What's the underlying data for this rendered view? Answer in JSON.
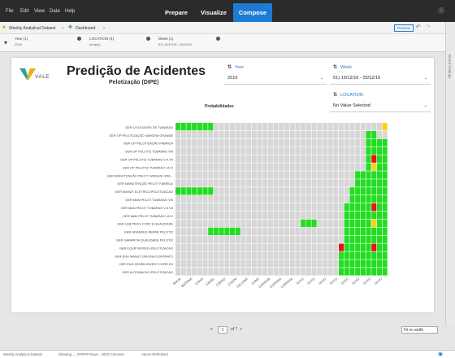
{
  "menubar": {
    "menus": [
      "File",
      "Edit",
      "View",
      "Data",
      "Help"
    ],
    "tabs": [
      "Prepare",
      "Visualize",
      "Compose"
    ],
    "active_tab": "Compose"
  },
  "toolbar": {
    "dataset": "Weekly Analytical Dataset",
    "canvas": "Dashboard",
    "preview": "Preview"
  },
  "filter_bar": [
    {
      "label": "Year (1)",
      "value": "2016"
    },
    {
      "label": "LOCATION (4)",
      "value": "(empty)"
    },
    {
      "label": "Week (1)",
      "value": "51) 19/12/16 - 25/12/16"
    }
  ],
  "right_rail_label": "Board Settings",
  "header": {
    "logo_text": "VALE",
    "title": "Predição de Acidentes",
    "subtitle": "Pelotização (DIPE)"
  },
  "filters": {
    "year": {
      "label": "Year",
      "value": "2016"
    },
    "week": {
      "label": "Week",
      "value": "51) 19/12/16 - 25/12/16"
    },
    "location": {
      "label": "LOCATION",
      "value": "No Value Selected"
    }
  },
  "chart_data": {
    "type": "heatmap",
    "title": "Probabilidades",
    "rows": [
      "GER UTILIDADES DE TUBARAO",
      "GER OP PELOTIZAÇÃO VARGEM GRANDE",
      "GER OP PELOTIZAÇÃO FABRICA",
      "GER OP PELOTIZ TUBARAO VIII",
      "GER OP PELOTIZ TUBARAO V A VII",
      "GER OP PELOTIZ TUBARAO I A IV",
      "GER MANUTENÇÃO PELOT VARGEM GRA...",
      "GER MANUTENÇÃO PELOT FABRICA",
      "GER MANUT ELETRICA PELOTIZACAO",
      "GER MAN PELOT TUBARAO VIII",
      "GER MAN PELOT TUBARAO V A VII",
      "GER MAN PELOT TUBARAO I A IV",
      "GER LAB PROG CONT E QUALIDADE",
      "GER GRANDES REPAR PELOTIZ",
      "GER GARANTIA QUALIDADE PELOTIZ",
      "GER EQUIP MOVEIS PELOTIZACAO",
      "GER ENG MANUT OFICINA CONTRATO",
      "GER ENG DESEN INVEST CORR ES",
      "GER AUTOMACAO PELOTIZACAO"
    ],
    "columns": [
      "BACIA",
      "BACIA",
      "BATERIA",
      "CAIXA",
      "CANAL",
      "CANAL/CANALETA",
      "CANAL/CANALETA",
      "CARRO",
      "CHAPA",
      "CICLONE",
      "CONE",
      "CONE/CUNHA",
      "CORREIA",
      "CORREIA",
      "CORREIA",
      "CORREIA",
      "CORREIA",
      "CORREIA",
      "CORREIA",
      "CORREIA",
      "DUTO",
      "DUTO",
      "DUTO",
      "DUTO",
      "DUTO",
      "DUTO",
      "DUTO",
      "DUTO",
      "DUTO",
      "DUTO",
      "DUTO",
      "DUTO",
      "DUTO",
      "DUTO",
      "DUTO",
      "DUTO",
      "DUTO",
      "DUTO"
    ],
    "column_labels_visible": [
      "BACIA",
      "BATERIA",
      "CAIXA",
      "CANAL",
      "CARRO",
      "CHAPA",
      "CICLONE",
      "CONE",
      "CORREIA",
      "CORREIA",
      "CORREIA",
      "DUTO",
      "DUTO",
      "DUTO",
      "DUTO",
      "DUTO",
      "DUTO",
      "DUTO",
      "DUTO"
    ],
    "level_colors": {
      "0": "#d7d7d7",
      "1": "#22dd22",
      "2": "#ee1111",
      "3": "#ffd21a"
    },
    "cells": [
      "111111100000000000000000000000000000003",
      "000000000000000000000000000000000001100",
      "000000000000000000000000000000000001111",
      "000000000000000000000000000000000001111",
      "000000000000000000000000000000000001211",
      "000000000000000000000000000000000001311",
      "000000000000000000000000000000000111111",
      "000000000000000000000000000000000111111",
      "111111100000000000000000000000001111111",
      "000000000000000000000000000000001111111",
      "000000000000000000000000000000011111211",
      "000000000000000000000000000000011111111",
      "000000000000000000000001110000011111311",
      "000000111111000000000000000000011111111",
      "000000000000000000000000000000011111111",
      "000000000000000000000000000000211111211",
      "000000000000000000000000000000111111111",
      "000000000000000000000000000000111111111",
      "000000000000000000000000000000111111111"
    ]
  },
  "pager": {
    "prev": "<",
    "page": "1",
    "of": "of 7",
    "next": ">",
    "zoom": "Fit to width"
  },
  "status_bar": {
    "dataset": "Weekly Analytical Dataset",
    "rows": "Showing ..., ###### Rows - 20/25 Columns",
    "refresh": "Never Refreshed"
  }
}
